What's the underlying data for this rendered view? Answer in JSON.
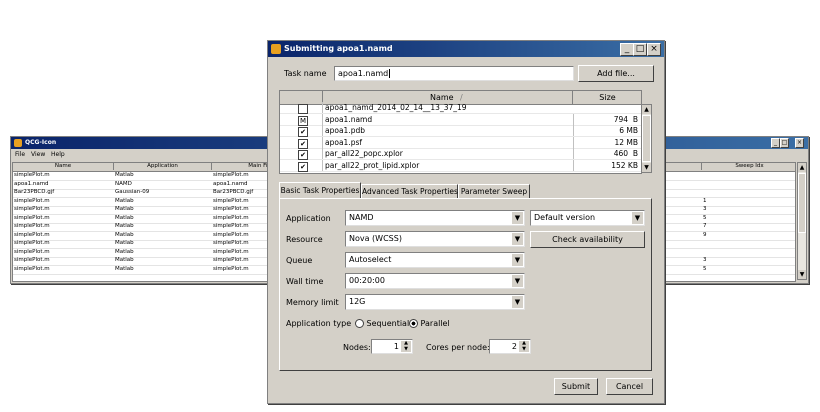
{
  "bg_window": {
    "title": "QCG-Icon",
    "menu": [
      "File",
      "View",
      "Help"
    ],
    "columns": [
      "Name",
      "Application",
      "Main Fil",
      "Sweep Idx"
    ],
    "rows": [
      {
        "name": "simplePlot.m",
        "app": "Matlab",
        "main": "simplePlot.m",
        "sweep": ""
      },
      {
        "name": "apoa1.namd",
        "app": "NAMD",
        "main": "apoa1.namd",
        "sweep": ""
      },
      {
        "name": "Bar23PBCD.gjf",
        "app": "Gaussian-09",
        "main": "Bar23PBCD.gjf",
        "sweep": ""
      },
      {
        "name": "simplePlot.m",
        "app": "Matlab",
        "main": "simplePlot.m",
        "sweep": "1"
      },
      {
        "name": "simplePlot.m",
        "app": "Matlab",
        "main": "simplePlot.m",
        "sweep": "3"
      },
      {
        "name": "simplePlot.m",
        "app": "Matlab",
        "main": "simplePlot.m",
        "sweep": "5"
      },
      {
        "name": "simplePlot.m",
        "app": "Matlab",
        "main": "simplePlot.m",
        "sweep": "7"
      },
      {
        "name": "simplePlot.m",
        "app": "Matlab",
        "main": "simplePlot.m",
        "sweep": "9"
      },
      {
        "name": "simplePlot.m",
        "app": "Matlab",
        "main": "simplePlot.m",
        "sweep": ""
      },
      {
        "name": "simplePlot.m",
        "app": "Matlab",
        "main": "simplePlot.m",
        "sweep": ""
      },
      {
        "name": "simplePlot.m",
        "app": "Matlab",
        "main": "simplePlot.m",
        "sweep": "3"
      },
      {
        "name": "simplePlot.m",
        "app": "Matlab",
        "main": "simplePlot.m",
        "sweep": "5"
      }
    ]
  },
  "dialog": {
    "title": "Submitting apoa1.namd",
    "task_name_label": "Task name",
    "task_name_value": "apoa1.namd",
    "add_file_label": "Add file...",
    "file_columns": {
      "name": "Name",
      "sort": "/",
      "size": "Size"
    },
    "files": [
      {
        "check": "",
        "name": "apoa1_namd_2014_02_14__13_37_19",
        "size": ""
      },
      {
        "check": "M",
        "name": "apoa1.namd",
        "size": "794  B"
      },
      {
        "check": "✔",
        "name": "apoa1.pdb",
        "size": "6 MB"
      },
      {
        "check": "✔",
        "name": "apoa1.psf",
        "size": "12 MB"
      },
      {
        "check": "✔",
        "name": "par_all22_popc.xplor",
        "size": "460  B"
      },
      {
        "check": "✔",
        "name": "par_all22_prot_lipid.xplor",
        "size": "152 KB"
      }
    ],
    "tabs": [
      "Basic Task Properties",
      "Advanced Task Properties",
      "Parameter Sweep"
    ],
    "application_label": "Application",
    "application_value": "NAMD",
    "version_value": "Default version",
    "resource_label": "Resource",
    "resource_value": "Nova (WCSS)",
    "check_availability_label": "Check availability",
    "queue_label": "Queue",
    "queue_value": "Autoselect",
    "walltime_label": "Wall time",
    "walltime_value": "00:20:00",
    "memory_label": "Memory limit",
    "memory_value": "12G",
    "apptype_label": "Application type",
    "sequential_label": "Sequential",
    "parallel_label": "Parallel",
    "nodes_label": "Nodes:",
    "nodes_value": "1",
    "cores_label": "Cores per node:",
    "cores_value": "2",
    "submit_label": "Submit",
    "cancel_label": "Cancel"
  }
}
